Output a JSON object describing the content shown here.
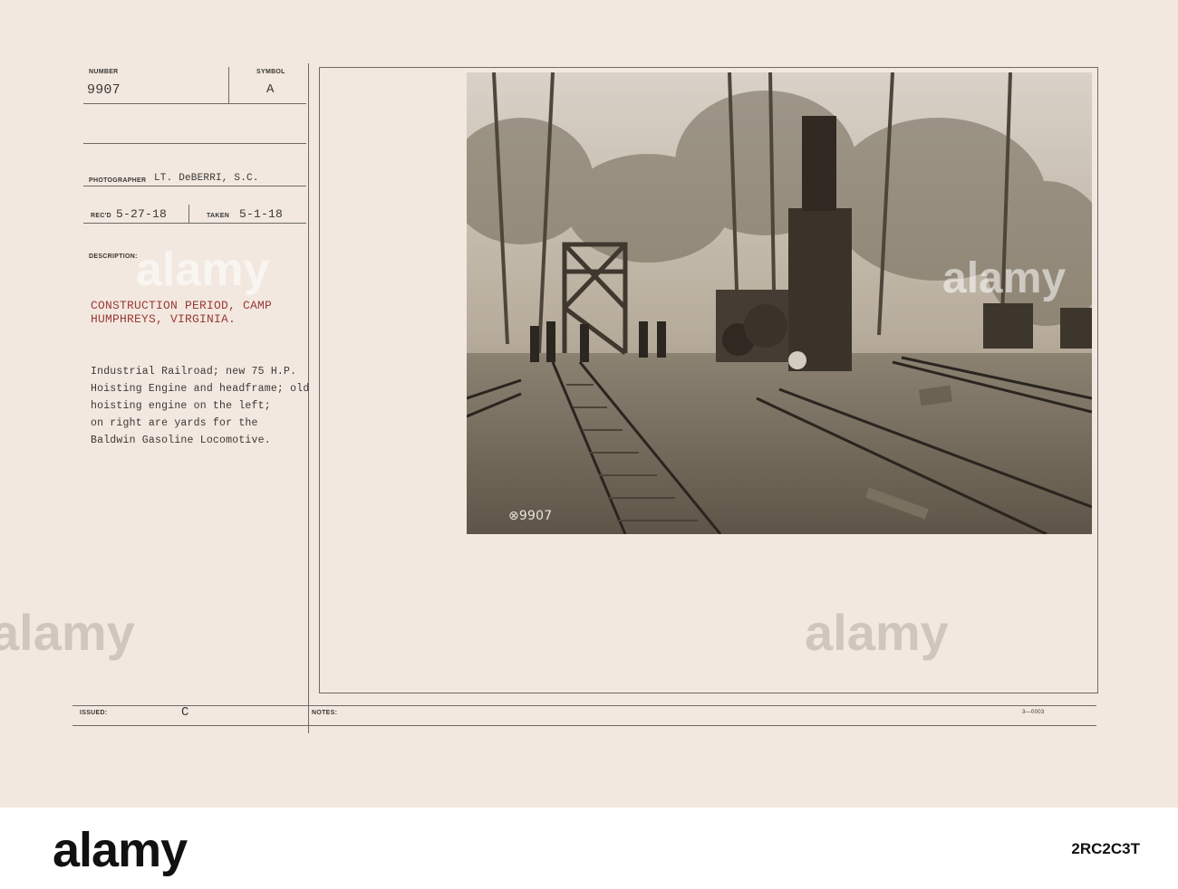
{
  "card": {
    "number_label": "NUMBER",
    "number_value": "9907",
    "symbol_label": "SYMBOL",
    "symbol_value": "A",
    "photographer_label": "PHOTOGRAPHER",
    "photographer_value": "LT. DeBERRI, S.C.",
    "recd_label": "REC'D",
    "recd_value": "5-27-18",
    "taken_label": "TAKEN",
    "taken_value": "5-1-18",
    "description_label": "DESCRIPTION:",
    "title_lines": [
      "CONSTRUCTION PERIOD, CAMP",
      "HUMPHREYS, VIRGINIA."
    ],
    "description_lines": [
      "Industrial Railroad; new 75 H.P.",
      "Hoisting Engine and headframe; old",
      "hoisting engine on the left;",
      "on right are yards for the",
      "Baldwin Gasoline Locomotive."
    ],
    "issued_label": "ISSUED:",
    "issued_value": "C",
    "notes_label": "NOTES:",
    "form_number": "3—0003",
    "photo_caption": "⊗9907"
  },
  "watermark": {
    "text": "alamy"
  },
  "footer": {
    "logo": "alamy",
    "stock_id": "2RC2C3T"
  }
}
